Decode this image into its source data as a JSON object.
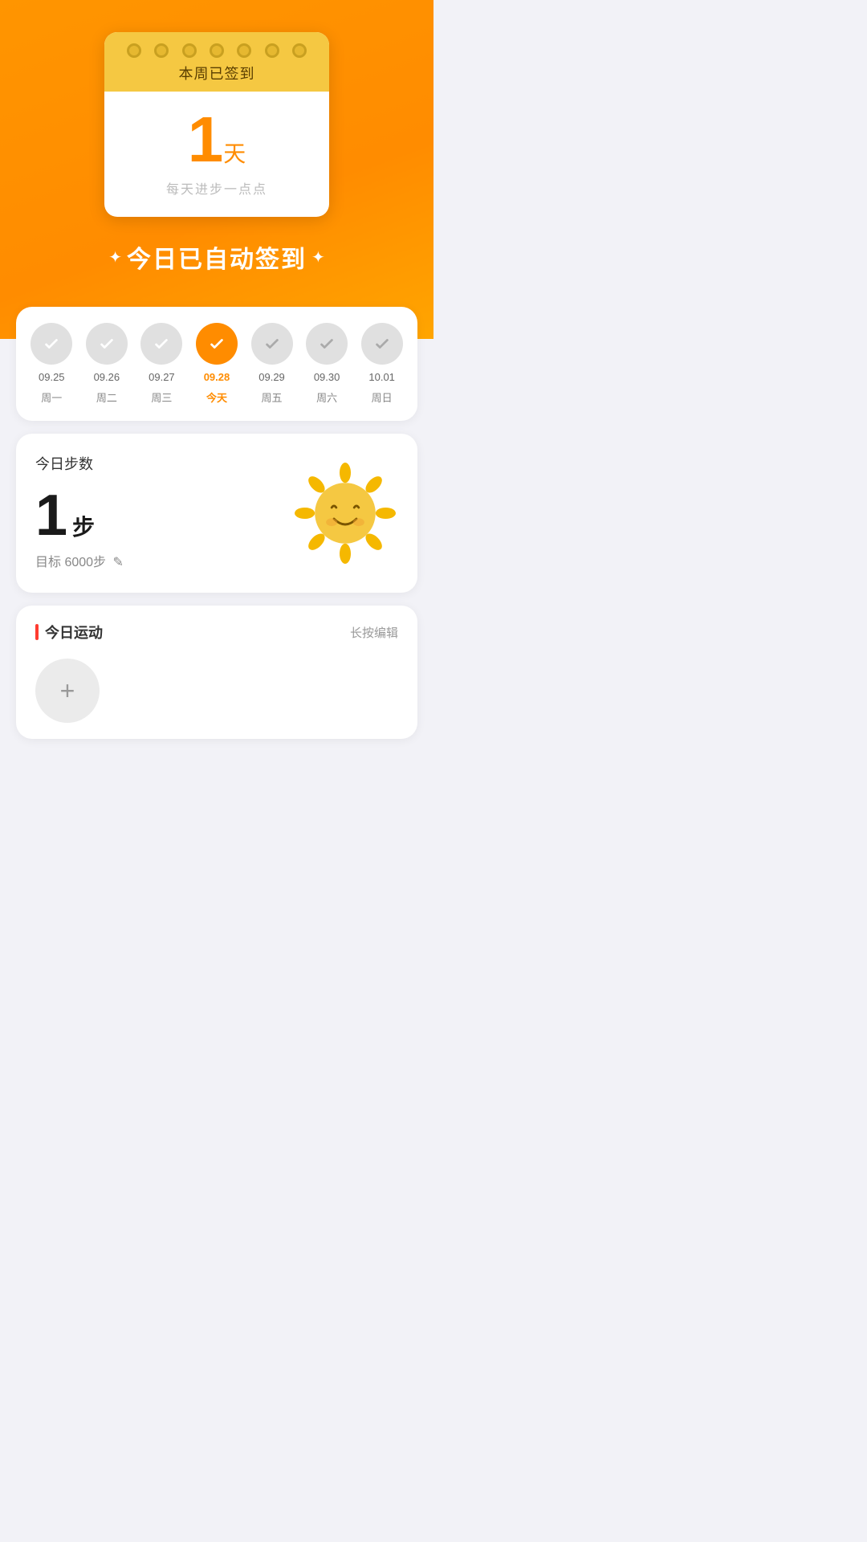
{
  "header": {
    "checkin_header": "本周已签到",
    "days_count": "1",
    "days_unit": "天",
    "subtitle": "每天进步一点点",
    "auto_sign_text": "今日已自动签到"
  },
  "week": {
    "days": [
      {
        "date": "09.25",
        "label": "周一",
        "checked": true,
        "today": false
      },
      {
        "date": "09.26",
        "label": "周二",
        "checked": true,
        "today": false
      },
      {
        "date": "09.27",
        "label": "周三",
        "checked": true,
        "today": false
      },
      {
        "date": "09.28",
        "label": "今天",
        "checked": true,
        "today": true
      },
      {
        "date": "09.29",
        "label": "周五",
        "checked": false,
        "today": false
      },
      {
        "date": "09.30",
        "label": "周六",
        "checked": false,
        "today": false
      },
      {
        "date": "10.01",
        "label": "周日",
        "checked": false,
        "today": false
      }
    ]
  },
  "steps": {
    "title": "今日步数",
    "count": "1",
    "unit": "步",
    "goal_label": "目标 6000步"
  },
  "exercise": {
    "title": "今日运动",
    "edit_label": "长按编辑",
    "add_label": "+"
  }
}
